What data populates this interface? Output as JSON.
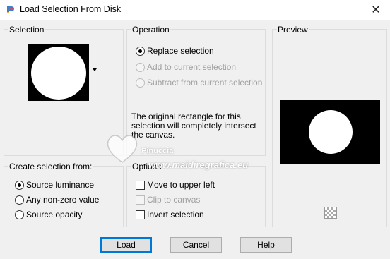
{
  "window": {
    "title": "Load Selection From Disk",
    "close_glyph": "✕"
  },
  "selection": {
    "label": "Selection"
  },
  "operation": {
    "label": "Operation",
    "options": [
      {
        "label": "Replace selection",
        "selected": true,
        "enabled": true
      },
      {
        "label": "Add to current selection",
        "selected": false,
        "enabled": false
      },
      {
        "label": "Subtract from current selection",
        "selected": false,
        "enabled": false
      }
    ],
    "info_text": "The original rectangle for this selection will completely intersect the canvas."
  },
  "preview": {
    "label": "Preview"
  },
  "create_from": {
    "label": "Create selection from:",
    "options": [
      {
        "label": "Source luminance",
        "selected": true
      },
      {
        "label": "Any non-zero value",
        "selected": false
      },
      {
        "label": "Source opacity",
        "selected": false
      }
    ]
  },
  "options": {
    "label": "Options",
    "items": [
      {
        "label": "Move to upper left",
        "checked": false,
        "enabled": true
      },
      {
        "label": "Clip to canvas",
        "checked": false,
        "enabled": false
      },
      {
        "label": "Invert selection",
        "checked": false,
        "enabled": true
      }
    ]
  },
  "watermark": {
    "brand": "Pinuccia",
    "site": "www.maidiregrafica.eu"
  },
  "buttons": {
    "load": "Load",
    "cancel": "Cancel",
    "help": "Help"
  },
  "icons": {
    "app": "psp-app-icon",
    "checker": "transparency-checker-icon"
  },
  "colors": {
    "accent": "#0078d7",
    "window_bg": "#f0f0f0",
    "group_border": "#dcdcdc"
  }
}
